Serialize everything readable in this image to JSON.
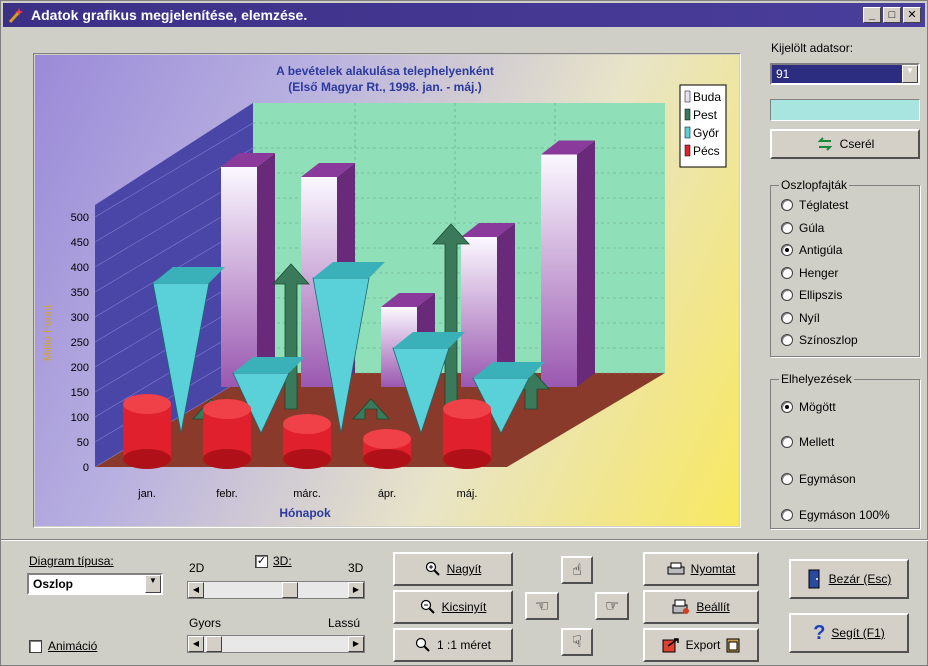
{
  "window": {
    "title": "Adatok grafikus megjelenítése, elemzése."
  },
  "chart_data": {
    "type": "bar",
    "title": "A bevételek alakulása telephelyenként",
    "subtitle": "(Első Magyar Rt., 1998. jan. - máj.)",
    "xlabel": "Hónapok",
    "ylabel": "Millió Forint",
    "categories": [
      "jan.",
      "febr.",
      "márc.",
      "ápr.",
      "máj."
    ],
    "ylim": [
      0,
      500
    ],
    "yticks": [
      "0",
      "50",
      "100",
      "150",
      "200",
      "250",
      "300",
      "350",
      "400",
      "450",
      "500"
    ],
    "series": [
      {
        "name": "Buda",
        "values": [
          440,
          420,
          160,
          300,
          465
        ],
        "color": "#e8e0f0"
      },
      {
        "name": "Pest",
        "values": [
          20,
          290,
          20,
          370,
          80
        ],
        "color": "#3a7a5a"
      },
      {
        "name": "Győr",
        "values": [
          300,
          120,
          310,
          170,
          110
        ],
        "color": "#5ad0d8"
      },
      {
        "name": "Pécs",
        "values": [
          110,
          100,
          70,
          40,
          100
        ],
        "color": "#e0202c"
      }
    ],
    "legend_position": "top-right",
    "grid": true
  },
  "right_panel": {
    "series_select_label": "Kijelölt adatsor:",
    "series_select_value": "91",
    "swap_button": "Cserél",
    "bar_types_label": "Oszlopfajták",
    "bar_types": [
      "Téglatest",
      "Gúla",
      "Antigúla",
      "Henger",
      "Ellipszis",
      "Nyíl",
      "Színoszlop"
    ],
    "bar_type_selected": "Antigúla",
    "placement_label": "Elhelyezések",
    "placements": [
      "Mögött",
      "Mellett",
      "Egymáson",
      "Egymáson 100%"
    ],
    "placement_selected": "Mögött"
  },
  "bottom": {
    "diagram_type_label": "Diagram típusa:",
    "diagram_type_value": "Oszlop",
    "animation_label": "Animáció",
    "label_2d": "2D",
    "label_3d_check": "3D:",
    "label_3d": "3D",
    "label_fast": "Gyors",
    "label_slow": "Lassú",
    "zoom_in": "Nagyít",
    "zoom_out": "Kicsinyít",
    "actual_size": "1 :1 méret",
    "print": "Nyomtat",
    "setup": "Beállít",
    "export": "Export",
    "close": "Bezár (Esc)",
    "help": "Segít (F1)"
  }
}
